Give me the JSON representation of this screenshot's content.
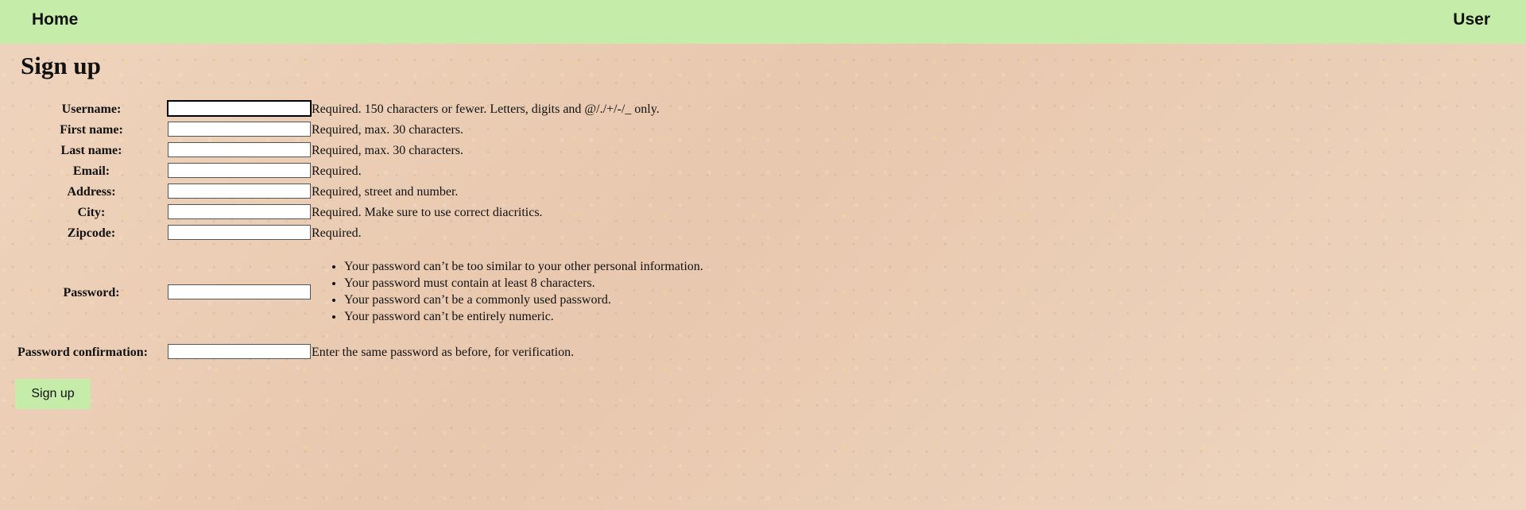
{
  "nav": {
    "home": "Home",
    "user": "User"
  },
  "page": {
    "title": "Sign up"
  },
  "form": {
    "fields": [
      {
        "label": "Username:",
        "value": "",
        "help": "Required. 150 characters or fewer. Letters, digits and @/./+/-/_ only."
      },
      {
        "label": "First name:",
        "value": "",
        "help": "Required, max. 30 characters."
      },
      {
        "label": "Last name:",
        "value": "",
        "help": "Required, max. 30 characters."
      },
      {
        "label": "Email:",
        "value": "",
        "help": "Required."
      },
      {
        "label": "Address:",
        "value": "",
        "help": "Required, street and number."
      },
      {
        "label": "City:",
        "value": "",
        "help": "Required. Make sure to use correct diacritics."
      },
      {
        "label": "Zipcode:",
        "value": "",
        "help": "Required."
      }
    ],
    "password": {
      "label": "Password:",
      "value": "",
      "rules": [
        "Your password can’t be too similar to your other personal information.",
        "Your password must contain at least 8 characters.",
        "Your password can’t be a commonly used password.",
        "Your password can’t be entirely numeric."
      ]
    },
    "password_confirmation": {
      "label": "Password confirmation:",
      "value": "",
      "help": "Enter the same password as before, for verification."
    },
    "submit_label": "Sign up"
  }
}
